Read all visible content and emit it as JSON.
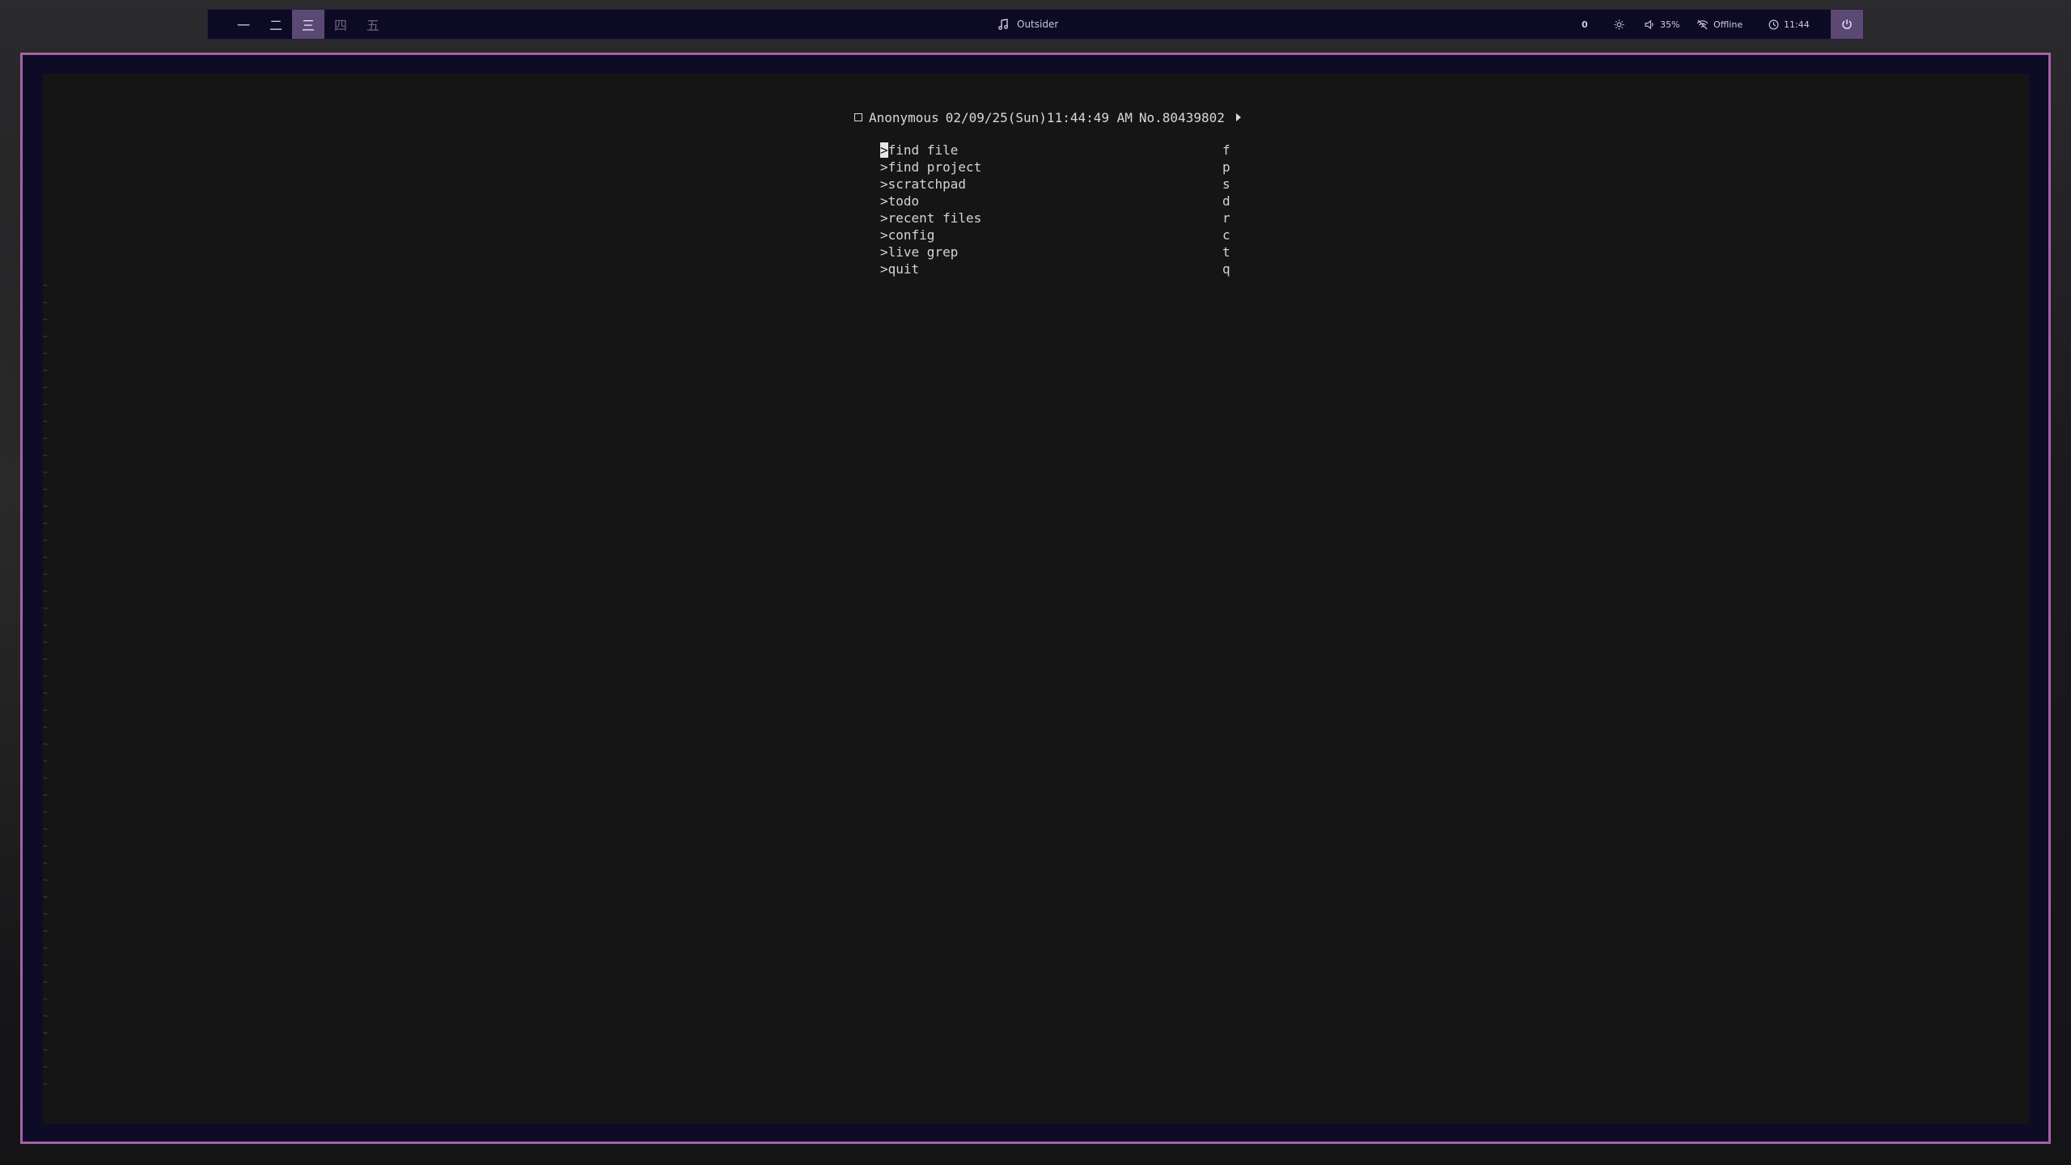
{
  "topbar": {
    "workspaces": [
      {
        "label": "一",
        "active": false
      },
      {
        "label": "二",
        "active": false
      },
      {
        "label": "三",
        "active": true
      },
      {
        "label": "四",
        "active": false
      },
      {
        "label": "五",
        "active": false
      }
    ],
    "music": {
      "icon": "music-note-icon",
      "title": "Outsider"
    },
    "tray": {
      "notification_count": "0",
      "brightness_icon": "sun-icon",
      "volume_icon": "speaker-icon",
      "volume": "35%",
      "network_icon": "wifi-off-icon",
      "network": "Offline",
      "clock_icon": "clock-icon",
      "time": "11:44",
      "power_icon": "power-icon"
    },
    "colors": {
      "bar_bg": "#0d0b24",
      "active_ws": "#5b4873",
      "accent_border": "#a661a4"
    }
  },
  "terminal": {
    "header": {
      "name": "Anonymous",
      "datetime": "02/09/25(Sun)11:44:49 AM",
      "post_no": "No.80439802"
    },
    "menu": [
      {
        "label": "find file",
        "key": "f"
      },
      {
        "label": "find project",
        "key": "p"
      },
      {
        "label": "scratchpad",
        "key": "s"
      },
      {
        "label": "todo",
        "key": "d"
      },
      {
        "label": "recent files",
        "key": "r"
      },
      {
        "label": "config",
        "key": "c"
      },
      {
        "label": "live grep",
        "key": "t"
      },
      {
        "label": "quit",
        "key": "q"
      }
    ],
    "prompt_char": ">",
    "empty_line_marker": "~"
  }
}
